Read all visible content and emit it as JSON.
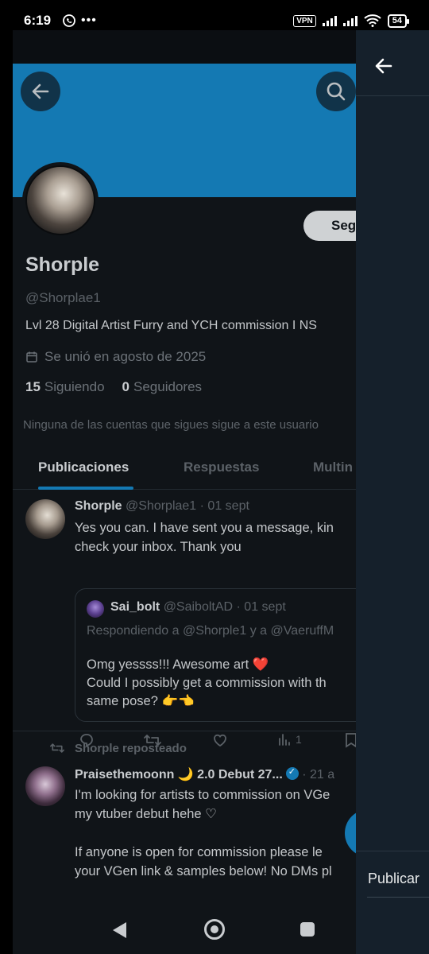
{
  "status_bar": {
    "time": "6:19",
    "vpn": "VPN",
    "battery": "54"
  },
  "profile": {
    "display_name": "Shorple",
    "handle": "@Shorplae1",
    "bio": "Lvl 28 Digital Artist Furry and YCH commission I NS",
    "joined": "Se unió en agosto de 2025",
    "following_count": "15",
    "following_label": "Siguiendo",
    "followers_count": "0",
    "followers_label": "Seguidores",
    "mutuals": "Ninguna de las cuentas que sigues sigue a este usuario",
    "follow_button": "Seg"
  },
  "tabs": [
    {
      "label": "Publicaciones",
      "active": true
    },
    {
      "label": "Respuestas",
      "active": false
    },
    {
      "label": "Multin",
      "active": false
    }
  ],
  "tweet1": {
    "name": "Shorple",
    "handle": "@Shorplae1",
    "date": "· 01 sept",
    "line1": "Yes you can. I have sent you a message, kin",
    "line2": "check your inbox. Thank you",
    "quote": {
      "name": "Sai_bolt",
      "handle": "@SaiboltAD",
      "date": "· 01 sept",
      "replying": "Respondiendo a @Shorple1 y a @VaeruffM",
      "line1": "Omg yessss!!! Awesome art ❤️",
      "line2": "Could I possibly get a commission with th",
      "line3": "same pose? 👉👈"
    },
    "views": "1"
  },
  "repost_label": "Shorple reposteado",
  "tweet2": {
    "name": "Praisethemoonn 🌙 2.0 Debut 27...",
    "date": "· 21 a",
    "line1": "I'm looking for artists to commission on VGe",
    "line2": "my vtuber debut hehe ♡",
    "line3": "If anyone is open for commission please le",
    "line4": "your VGen link & samples below! No DMs pl"
  },
  "drawer": {
    "publish": "Publicar"
  },
  "icons": {
    "back": "arrow-left-icon",
    "search": "search-icon",
    "calendar": "calendar-icon",
    "reply": "reply-icon",
    "retweet": "retweet-icon",
    "like": "heart-icon",
    "views": "views-icon",
    "bookmark": "bookmark-icon",
    "verified": "verified-badge-icon"
  }
}
